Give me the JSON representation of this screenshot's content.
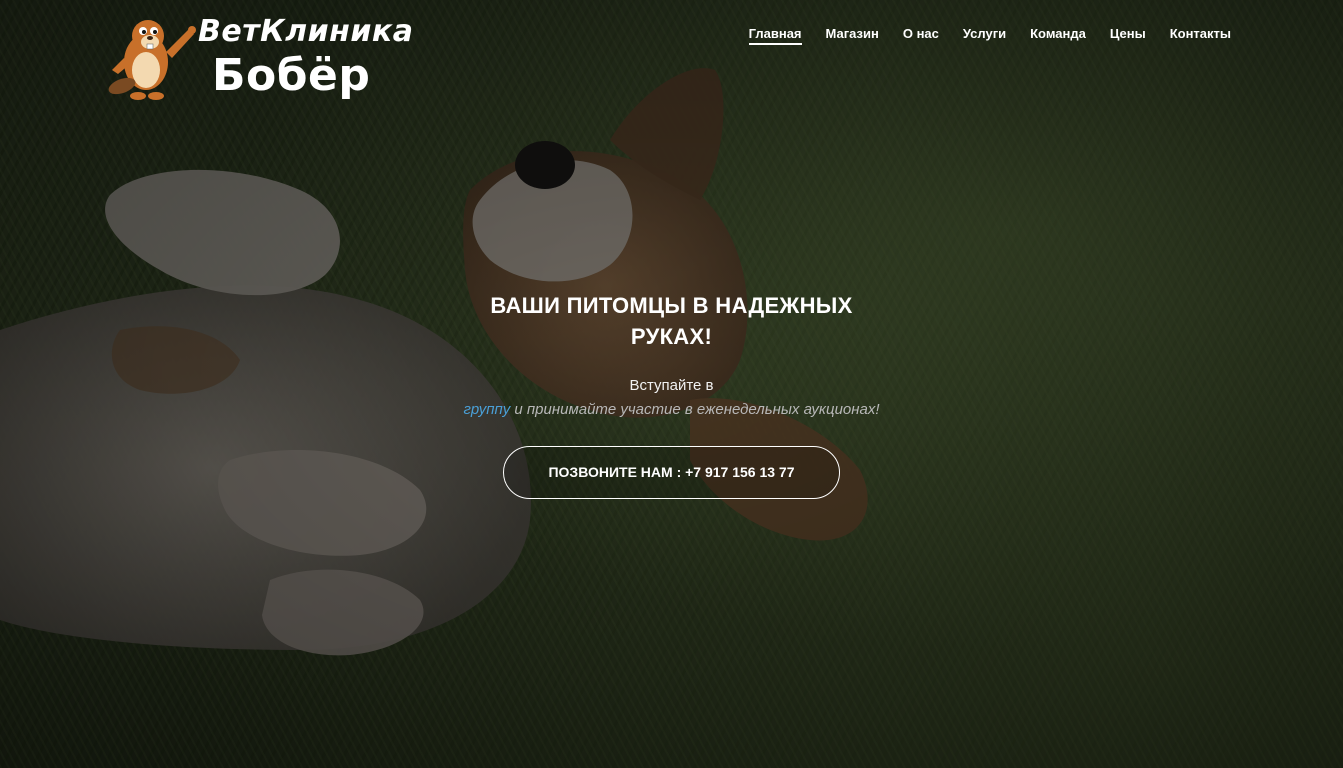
{
  "logo": {
    "line1": "ВетКлиника",
    "line2": "Бобёр",
    "mascot_icon": "beaver-mascot-icon"
  },
  "nav": {
    "items": [
      {
        "label": "Главная",
        "active": true
      },
      {
        "label": "Магазин",
        "active": false
      },
      {
        "label": "О нас",
        "active": false
      },
      {
        "label": "Услуги",
        "active": false
      },
      {
        "label": "Команда",
        "active": false
      },
      {
        "label": "Цены",
        "active": false
      },
      {
        "label": "Контакты",
        "active": false
      }
    ]
  },
  "hero": {
    "headline": "ВАШИ ПИТОМЦЫ В НАДЕЖНЫХ РУКАХ!",
    "line1": "Вступайте в",
    "group_link": "группу",
    "line2_rest": " и принимайте участие в еженедельных аукционах!",
    "cta_label": "ПОЗВОНИТЕ НАМ : +7 917 156 13 77"
  },
  "colors": {
    "link": "#4a9fd6",
    "text": "#ffffff",
    "background": "#1f2718"
  }
}
